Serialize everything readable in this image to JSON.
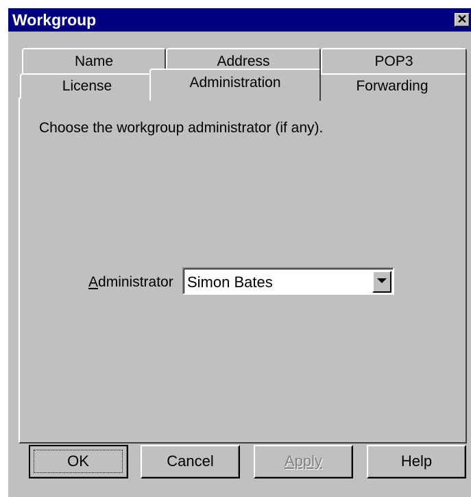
{
  "window": {
    "title": "Workgroup",
    "close_glyph": "✕"
  },
  "tabs": {
    "row1": [
      "Name",
      "Address",
      "POP3"
    ],
    "row2": [
      "License",
      "Administration",
      "Forwarding"
    ],
    "active": "Administration"
  },
  "panel": {
    "instruction": "Choose the workgroup administrator (if any).",
    "admin_label_first": "A",
    "admin_label_rest": "dministrator",
    "admin_value": "Simon Bates"
  },
  "buttons": {
    "ok": "OK",
    "cancel": "Cancel",
    "apply": "Apply",
    "help": "Help"
  }
}
